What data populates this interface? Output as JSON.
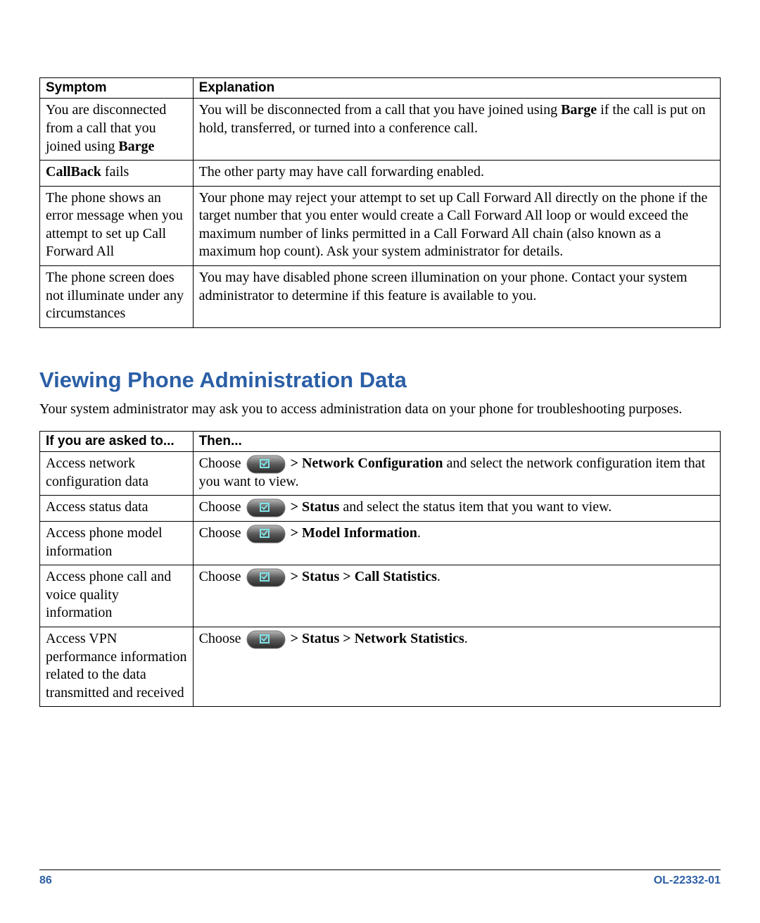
{
  "table1": {
    "headers": {
      "col1": "Symptom",
      "col2": "Explanation"
    },
    "rows": [
      {
        "symptom_pre": "You are disconnected from a call that you joined using ",
        "symptom_bold": "Barge",
        "explanation_pre": "You will be disconnected from a call that you have joined using ",
        "explanation_bold": "Barge",
        "explanation_post": " if the call is put on hold, transferred, or turned into a conference call."
      },
      {
        "symptom_bold": "CallBack",
        "symptom_post": " fails",
        "explanation": "The other party may have call forwarding enabled."
      },
      {
        "symptom": "The phone shows an error message when you attempt to set up Call Forward All",
        "explanation": "Your phone may reject your attempt to set up Call Forward All directly on the phone if the target number that you enter would create a Call Forward All loop or would exceed the maximum number of links permitted in a Call Forward All chain (also known as a maximum hop count). Ask your system administrator for details."
      },
      {
        "symptom": "The phone screen does not illuminate under any circumstances",
        "explanation": "You may have disabled phone screen illumination on your phone. Contact your system administrator to determine if this feature is available to you."
      }
    ]
  },
  "section_heading": "Viewing Phone Administration Data",
  "intro_text": "Your system administrator may ask you to access administration data on your phone for troubleshooting purposes.",
  "table2": {
    "headers": {
      "col1": "If you are asked to...",
      "col2": "Then..."
    },
    "rows": [
      {
        "asked": "Access network configuration data",
        "choose": "Choose ",
        "bold": " > Network Configuration",
        "post": " and select the network configuration item that you want to view."
      },
      {
        "asked": "Access status data",
        "choose": "Choose ",
        "bold": " > Status",
        "post": " and select the status item that you want to view."
      },
      {
        "asked": "Access phone model information",
        "choose": "Choose ",
        "bold": " > Model Information",
        "post": "."
      },
      {
        "asked": "Access phone call and voice quality information",
        "choose": "Choose ",
        "bold": " > Status > Call Statistics",
        "post": "."
      },
      {
        "asked": "Access VPN performance information related to the data transmitted and received",
        "choose": "Choose ",
        "bold": " > Status > Network Statistics",
        "post": "."
      }
    ]
  },
  "footer": {
    "page": "86",
    "docid": "OL-22332-01"
  }
}
